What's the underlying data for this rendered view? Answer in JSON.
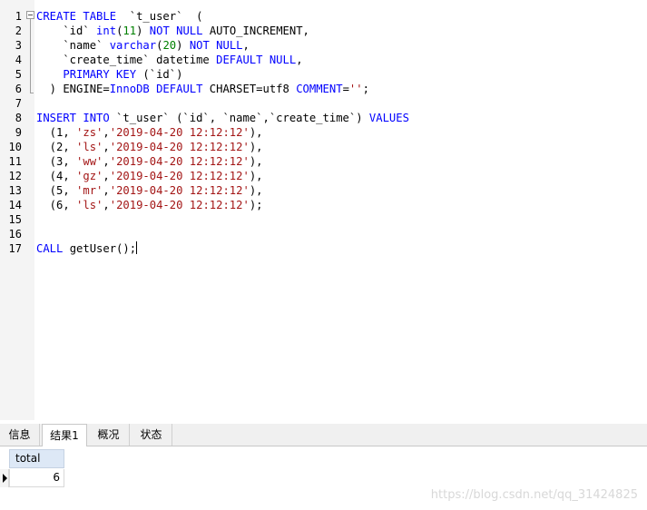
{
  "editor": {
    "line_numbers": [
      "1",
      "2",
      "3",
      "4",
      "5",
      "6",
      "7",
      "8",
      "9",
      "10",
      "11",
      "12",
      "13",
      "14",
      "15",
      "16",
      "17"
    ],
    "lines": [
      [
        {
          "t": "CREATE TABLE",
          "c": "kw"
        },
        {
          "t": "  `t_user`  (",
          "c": ""
        }
      ],
      [
        {
          "t": "    `id` ",
          "c": ""
        },
        {
          "t": "int",
          "c": "kw"
        },
        {
          "t": "(",
          "c": ""
        },
        {
          "t": "11",
          "c": "num"
        },
        {
          "t": ") ",
          "c": ""
        },
        {
          "t": "NOT NULL",
          "c": "kw"
        },
        {
          "t": " AUTO_INCREMENT,",
          "c": ""
        }
      ],
      [
        {
          "t": "    `name` ",
          "c": ""
        },
        {
          "t": "varchar",
          "c": "kw"
        },
        {
          "t": "(",
          "c": ""
        },
        {
          "t": "20",
          "c": "num"
        },
        {
          "t": ") ",
          "c": ""
        },
        {
          "t": "NOT NULL",
          "c": "kw"
        },
        {
          "t": ",",
          "c": ""
        }
      ],
      [
        {
          "t": "    `create_time` datetime ",
          "c": ""
        },
        {
          "t": "DEFAULT NULL",
          "c": "kw"
        },
        {
          "t": ",",
          "c": ""
        }
      ],
      [
        {
          "t": "    ",
          "c": ""
        },
        {
          "t": "PRIMARY KEY",
          "c": "kw"
        },
        {
          "t": " (`id`)",
          "c": ""
        }
      ],
      [
        {
          "t": "  ) ENGINE=",
          "c": ""
        },
        {
          "t": "InnoDB",
          "c": "kw"
        },
        {
          "t": " ",
          "c": ""
        },
        {
          "t": "DEFAULT",
          "c": "kw"
        },
        {
          "t": " CHARSET=utf8 ",
          "c": ""
        },
        {
          "t": "COMMENT",
          "c": "kw"
        },
        {
          "t": "=",
          "c": ""
        },
        {
          "t": "''",
          "c": "str"
        },
        {
          "t": ";",
          "c": ""
        }
      ],
      [],
      [
        {
          "t": "INSERT INTO",
          "c": "kw"
        },
        {
          "t": " `t_user` (`id`, `name`,`create_time`) ",
          "c": ""
        },
        {
          "t": "VALUES",
          "c": "kw"
        }
      ],
      [
        {
          "t": "  (1, ",
          "c": ""
        },
        {
          "t": "'zs'",
          "c": "str"
        },
        {
          "t": ",",
          "c": ""
        },
        {
          "t": "'2019-04-20 12:12:12'",
          "c": "str"
        },
        {
          "t": "),",
          "c": ""
        }
      ],
      [
        {
          "t": "  (2, ",
          "c": ""
        },
        {
          "t": "'ls'",
          "c": "str"
        },
        {
          "t": ",",
          "c": ""
        },
        {
          "t": "'2019-04-20 12:12:12'",
          "c": "str"
        },
        {
          "t": "),",
          "c": ""
        }
      ],
      [
        {
          "t": "  (3, ",
          "c": ""
        },
        {
          "t": "'ww'",
          "c": "str"
        },
        {
          "t": ",",
          "c": ""
        },
        {
          "t": "'2019-04-20 12:12:12'",
          "c": "str"
        },
        {
          "t": "),",
          "c": ""
        }
      ],
      [
        {
          "t": "  (4, ",
          "c": ""
        },
        {
          "t": "'gz'",
          "c": "str"
        },
        {
          "t": ",",
          "c": ""
        },
        {
          "t": "'2019-04-20 12:12:12'",
          "c": "str"
        },
        {
          "t": "),",
          "c": ""
        }
      ],
      [
        {
          "t": "  (5, ",
          "c": ""
        },
        {
          "t": "'mr'",
          "c": "str"
        },
        {
          "t": ",",
          "c": ""
        },
        {
          "t": "'2019-04-20 12:12:12'",
          "c": "str"
        },
        {
          "t": "),",
          "c": ""
        }
      ],
      [
        {
          "t": "  (6, ",
          "c": ""
        },
        {
          "t": "'ls'",
          "c": "str"
        },
        {
          "t": ",",
          "c": ""
        },
        {
          "t": "'2019-04-20 12:12:12'",
          "c": "str"
        },
        {
          "t": ");",
          "c": ""
        }
      ],
      [],
      [],
      [
        {
          "t": "CALL",
          "c": "kw"
        },
        {
          "t": " getUser();",
          "c": ""
        }
      ]
    ],
    "colors": {
      "keyword": "#0000ff",
      "number": "#008000",
      "string": "#a31515"
    }
  },
  "tabs": [
    "信息",
    "结果1",
    "概况",
    "状态"
  ],
  "active_tab": "结果1",
  "result": {
    "columns": [
      "total"
    ],
    "rows": [
      [
        "6"
      ]
    ]
  },
  "watermark": "https://blog.csdn.net/qq_31424825"
}
